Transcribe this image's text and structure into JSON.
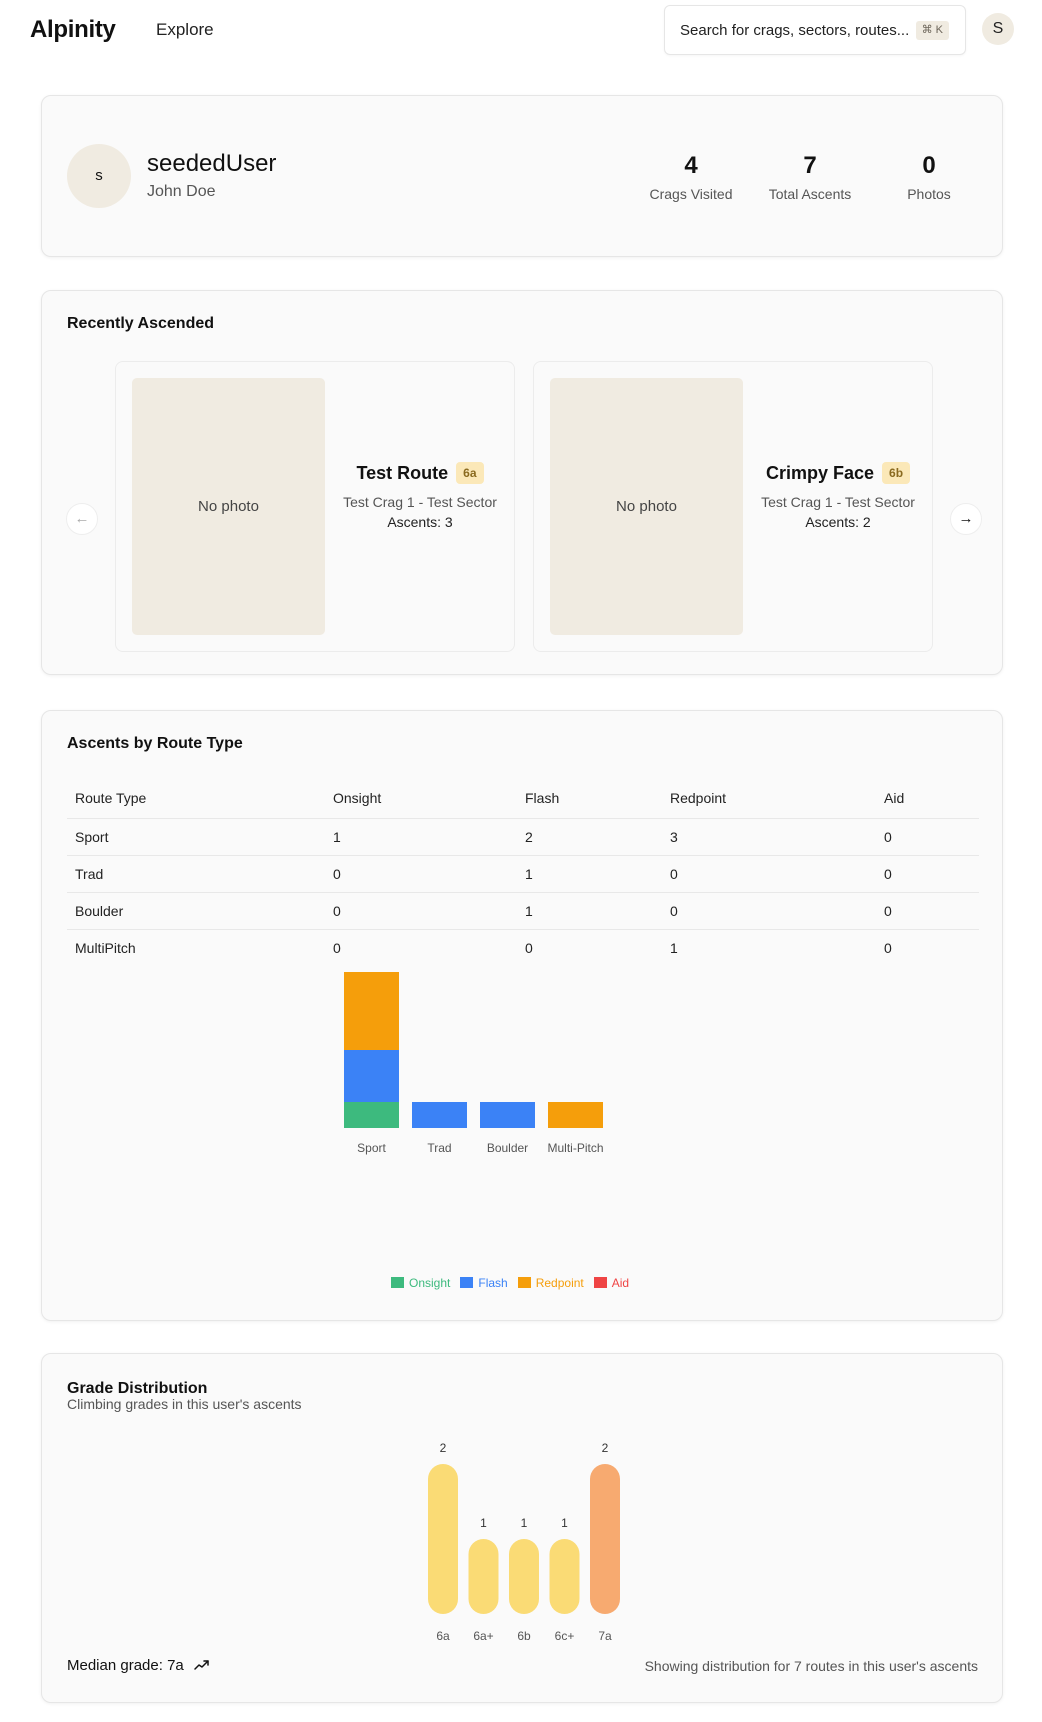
{
  "header": {
    "logo": "Alpinity",
    "nav_explore": "Explore",
    "search_placeholder": "Search for crags, sectors, routes...",
    "search_shortcut": "⌘ K",
    "user_initial": "S"
  },
  "profile": {
    "avatar_initial": "s",
    "username": "seededUser",
    "full_name": "John Doe",
    "stats": [
      {
        "value": "4",
        "label": "Crags Visited"
      },
      {
        "value": "7",
        "label": "Total Ascents"
      },
      {
        "value": "0",
        "label": "Photos"
      }
    ]
  },
  "recent": {
    "title": "Recently Ascended",
    "routes": [
      {
        "photo": "No photo",
        "name": "Test Route",
        "grade": "6a",
        "location": "Test Crag 1 - Test Sector",
        "ascents": "Ascents: 3"
      },
      {
        "photo": "No photo",
        "name": "Crimpy Face",
        "grade": "6b",
        "location": "Test Crag 1 - Test Sector",
        "ascents": "Ascents: 2"
      }
    ],
    "prev_icon": "arrow-left-icon",
    "next_icon": "arrow-right-icon"
  },
  "route_types": {
    "title": "Ascents by Route Type",
    "columns": [
      "Route Type",
      "Onsight",
      "Flash",
      "Redpoint",
      "Aid"
    ],
    "rows": [
      [
        "Sport",
        "1",
        "2",
        "3",
        "0"
      ],
      [
        "Trad",
        "0",
        "1",
        "0",
        "0"
      ],
      [
        "Boulder",
        "0",
        "1",
        "0",
        "0"
      ],
      [
        "MultiPitch",
        "0",
        "0",
        "1",
        "0"
      ]
    ]
  },
  "grades": {
    "title": "Grade Distribution",
    "subtitle": "Climbing grades in this user's ascents",
    "median": "Median grade: 7a",
    "note": "Showing distribution for 7 routes in this user's ascents"
  },
  "colors": {
    "onsight": "#3dba7e",
    "flash": "#3b82f6",
    "redpoint": "#f59e0b",
    "aid": "#ef4444",
    "grade_bar": "#fadb75",
    "grade_bar_high": "#f7aa70"
  },
  "chart_data": [
    {
      "type": "bar",
      "stacked": true,
      "categories": [
        "Sport",
        "Trad",
        "Boulder",
        "Multi-Pitch"
      ],
      "series": [
        {
          "name": "Onsight",
          "values": [
            1,
            0,
            0,
            0
          ]
        },
        {
          "name": "Flash",
          "values": [
            2,
            1,
            1,
            0
          ]
        },
        {
          "name": "Redpoint",
          "values": [
            3,
            0,
            0,
            1
          ]
        },
        {
          "name": "Aid",
          "values": [
            0,
            0,
            0,
            0
          ]
        }
      ],
      "legend": "bottom",
      "grid": false
    },
    {
      "type": "bar",
      "categories": [
        "6a",
        "6a+",
        "6b",
        "6c+",
        "7a"
      ],
      "values": [
        2,
        1,
        1,
        1,
        2
      ],
      "data_labels": true,
      "grid": false
    }
  ]
}
